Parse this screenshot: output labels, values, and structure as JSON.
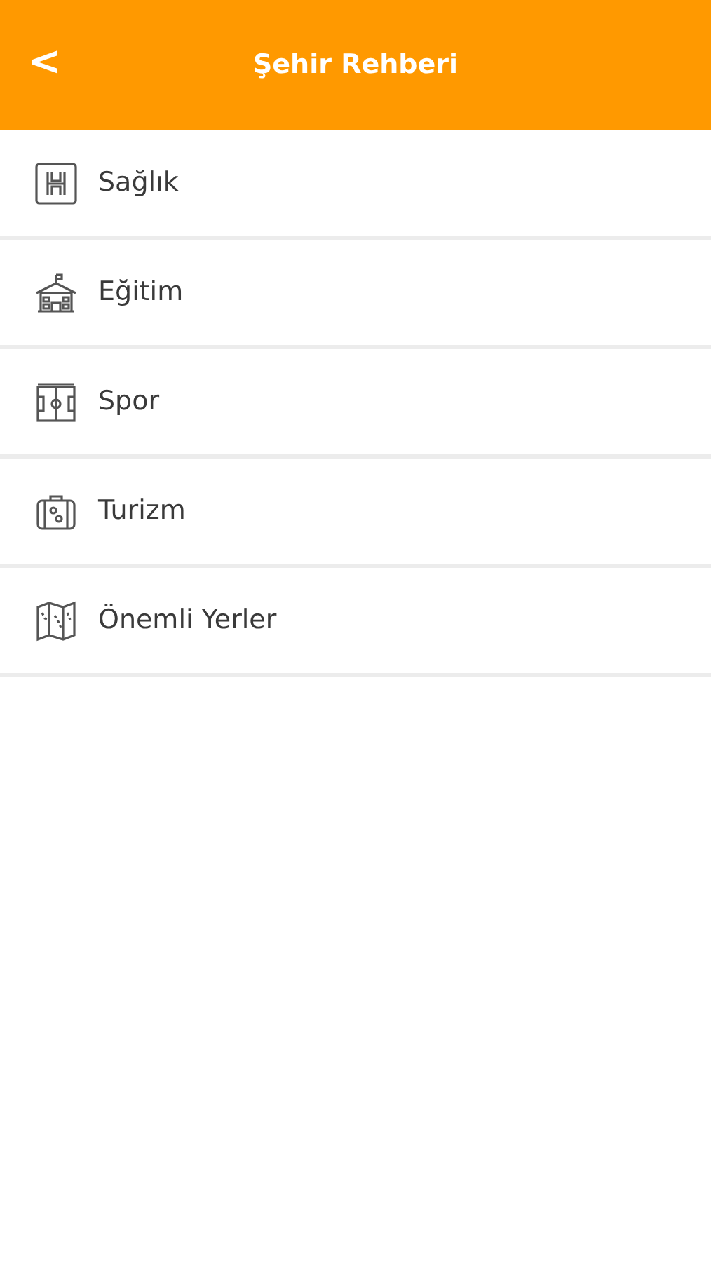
{
  "header": {
    "back": "<",
    "title": "Şehir Rehberi"
  },
  "items": [
    {
      "kind": "hospital",
      "label": "Sağlık"
    },
    {
      "kind": "school",
      "label": "Eğitim"
    },
    {
      "kind": "field",
      "label": "Spor"
    },
    {
      "kind": "suitcase",
      "label": "Turizm"
    },
    {
      "kind": "map",
      "label": "Önemli Yerler"
    }
  ]
}
